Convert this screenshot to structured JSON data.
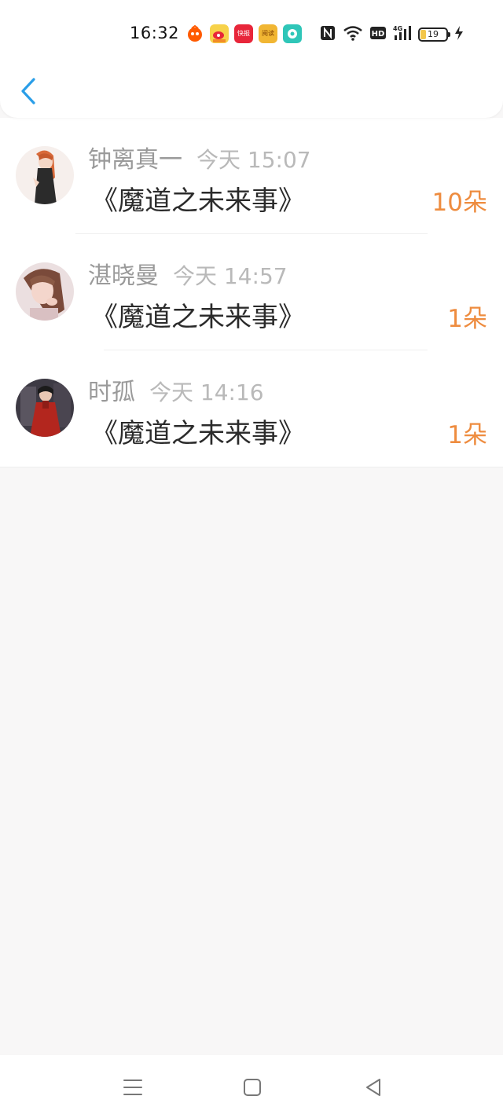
{
  "status_bar": {
    "time": "16:32",
    "app_icons": [
      {
        "name": "taobao-icon",
        "color": "#ff5a00",
        "label": ""
      },
      {
        "name": "weibo-icon",
        "color": "#f7c844",
        "label": ""
      },
      {
        "name": "news-app-icon",
        "color": "#e8263a",
        "label": "快报"
      },
      {
        "name": "reader-app-icon",
        "color": "#f1b633",
        "label": "阅读"
      },
      {
        "name": "chat-app-icon",
        "color": "#2fc6b8",
        "label": ""
      }
    ],
    "battery_level": "19"
  },
  "nav": {
    "back_icon": "chevron-left-icon",
    "accent_color": "#2a9ee8"
  },
  "gifts": [
    {
      "user": "钟离真一",
      "time": "今天 15:07",
      "book": "《魔道之未来事》",
      "count": "10朵",
      "avatar": {
        "bg": "#f4ecea",
        "hair": "#d86a3a",
        "skin": "#f5d7c6",
        "cloth": "#2b2b2b"
      }
    },
    {
      "user": "湛晓曼",
      "time": "今天 14:57",
      "book": "《魔道之未来事》",
      "count": "1朵",
      "avatar": {
        "bg": "#e9dcdc",
        "hair": "#7a4a3a",
        "skin": "#f4d6cc",
        "cloth": "#d9c0c2"
      }
    },
    {
      "user": "时孤",
      "time": "今天 14:16",
      "book": "《魔道之未来事》",
      "count": "1朵",
      "avatar": {
        "bg": "#3d3a44",
        "hair": "#1b1b1b",
        "skin": "#e8c8b4",
        "cloth": "#b3261e"
      }
    }
  ],
  "bottom_nav": [
    "menu-icon",
    "home-icon",
    "back-triangle-icon"
  ]
}
